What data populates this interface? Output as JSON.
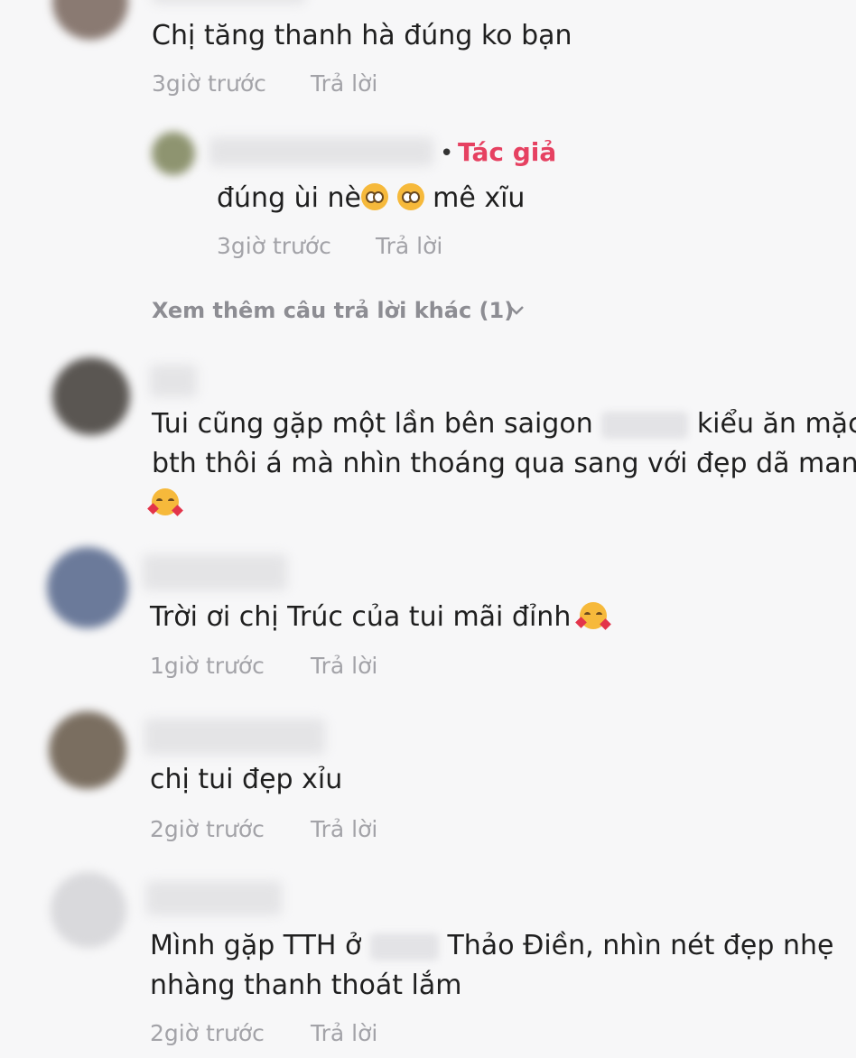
{
  "comments": [
    {
      "text": "Chị tăng thanh hà đúng ko bạn",
      "time": "3giờ trước",
      "reply_label": "Trả lời",
      "avatar_color": "#8a7a72"
    },
    {
      "text": "đúng ùi nè",
      "text_tail": "mê xĩu",
      "author_badge": "Tác giả",
      "time": "3giờ trước",
      "reply_label": "Trả lời",
      "avatar_color": "#8e9470",
      "icon": "pleading-face-icon"
    },
    {
      "text_line1": "Tui cũng gặp một lần bên saigon",
      "text_line1_tail": "kiểu ăn mặc",
      "text_line2": "bth thôi á mà nhìn thoáng qua sang với đẹp dã man",
      "avatar_color": "#5a5652",
      "icon": "smiling-face-with-hearts-icon"
    },
    {
      "text": "Trời ơi chị Trúc của tui mãi đỉnh",
      "time": "1giờ trước",
      "reply_label": "Trả lời",
      "avatar_color": "#6b7a9a",
      "icon": "smiling-face-with-hearts-icon"
    },
    {
      "text": "chị tui đẹp xỉu",
      "time": "2giờ trước",
      "reply_label": "Trả lời",
      "avatar_color": "#7a6e60"
    },
    {
      "text_line1": "Mình gặp TTH ở",
      "text_line1_tail": "Thảo Điền, nhìn nét đẹp nhẹ",
      "text_line2": "nhàng thanh thoát lắm",
      "time": "2giờ trước",
      "reply_label": "Trả lời",
      "avatar_color": "#d9d9dc"
    }
  ],
  "more_replies": "Xem thêm câu trả lời khác (1)",
  "colors": {
    "author": "#e64161",
    "meta": "#a3a3a8",
    "background": "#f7f7f8"
  }
}
